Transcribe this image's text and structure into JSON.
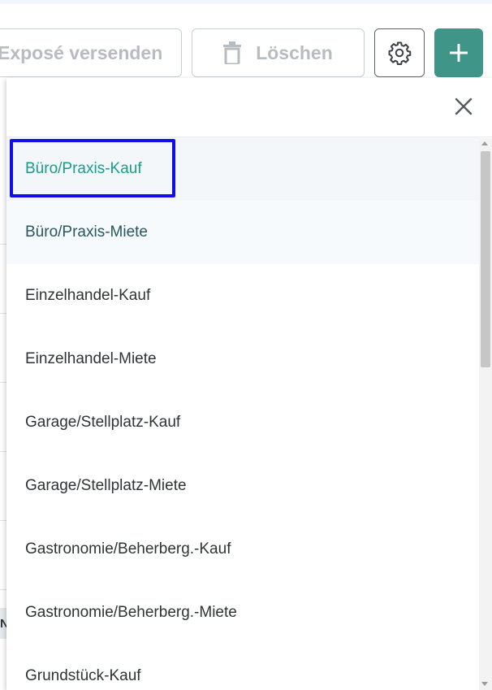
{
  "toolbar": {
    "expose_label": "Exposé versenden",
    "delete_label": "Löschen",
    "settings_icon": "gear-icon",
    "add_icon": "plus-icon",
    "accent_color": "#3f9688"
  },
  "background": {
    "row_letter": "N"
  },
  "dropdown": {
    "close_icon": "close-icon",
    "options": [
      {
        "label": "Büro/Praxis-Kauf",
        "state": "selected"
      },
      {
        "label": "Büro/Praxis-Miete",
        "state": "hover"
      },
      {
        "label": "Einzelhandel-Kauf"
      },
      {
        "label": "Einzelhandel-Miete"
      },
      {
        "label": "Garage/Stellplatz-Kauf"
      },
      {
        "label": "Garage/Stellplatz-Miete"
      },
      {
        "label": "Gastronomie/Beherberg.-Kauf"
      },
      {
        "label": "Gastronomie/Beherberg.-Miete"
      },
      {
        "label": "Grundstück-Kauf"
      }
    ],
    "selected_color": "#1a9b8a",
    "focus_color": "#1010e6"
  }
}
